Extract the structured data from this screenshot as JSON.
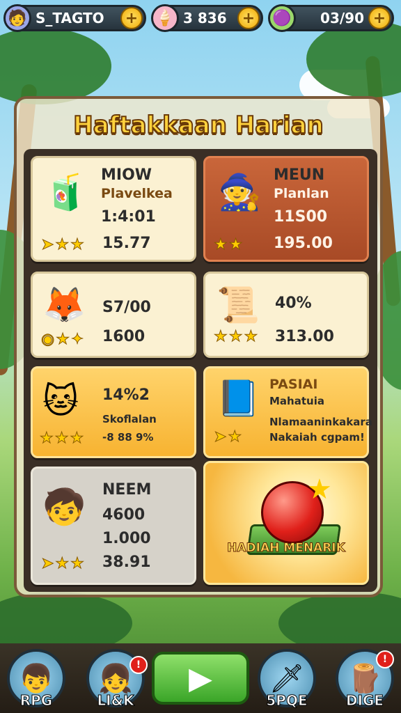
{
  "topbar": {
    "player_name": "S_TAGTO",
    "currency1": "3 836",
    "currency2": "03/90",
    "avatar_icon": "player-avatar-icon",
    "item_icon": "ice-cream-icon",
    "gem_icon": "gem-jar-icon"
  },
  "board": {
    "title": "Haftakkaan Harian",
    "cards": [
      {
        "title": "MIOW",
        "subtitle": "Plavelkea",
        "value": "1:4:01",
        "stat": "15.77",
        "icon": "juice-cup-icon"
      },
      {
        "title": "MEUN",
        "subtitle": "Planlan",
        "value": "11S00",
        "stat": "195.00",
        "icon": "hero-character-icon"
      },
      {
        "title": "",
        "subtitle": "",
        "value": "S7/00",
        "stat": "1600",
        "icon": "fox-pet-icon"
      },
      {
        "title": "",
        "subtitle": "",
        "value": "40%",
        "stat": "313.00",
        "icon": "scroll-item-icon"
      },
      {
        "title": "14%2",
        "subtitle": "Skoflalan",
        "value": "",
        "stat": "-8 88 9%",
        "icon": "cat-pet-icon"
      },
      {
        "title": "PASIAI",
        "subtitle": "Mahatuia",
        "value": "Nlamaaninkakara",
        "stat": "Nakaiah cgpam!",
        "icon": "card-book-icon"
      },
      {
        "title": "NEEM",
        "subtitle": "",
        "value": "4600",
        "stat2": "1.000",
        "stat": "38.91",
        "icon": "kid-phone-icon"
      },
      {
        "title": "",
        "subtitle": "",
        "value": "",
        "stat": "",
        "label": "HADIAH MENARIK",
        "icon": "red-orb-reward-icon"
      }
    ]
  },
  "bottom_nav": [
    {
      "label": "RPG",
      "icon": "boy-avatar-icon"
    },
    {
      "label": "LI&K",
      "icon": "girl-avatar-icon",
      "badge": "!"
    },
    {
      "label": "",
      "icon": "play-icon"
    },
    {
      "label": "5PQE",
      "icon": "sword-icon"
    },
    {
      "label": "DIGE",
      "icon": "wood-log-icon",
      "badge": "!"
    }
  ],
  "colors": {
    "accent": "#ffd23d",
    "board_border": "#7b5a3a",
    "play": "#3aa528"
  }
}
